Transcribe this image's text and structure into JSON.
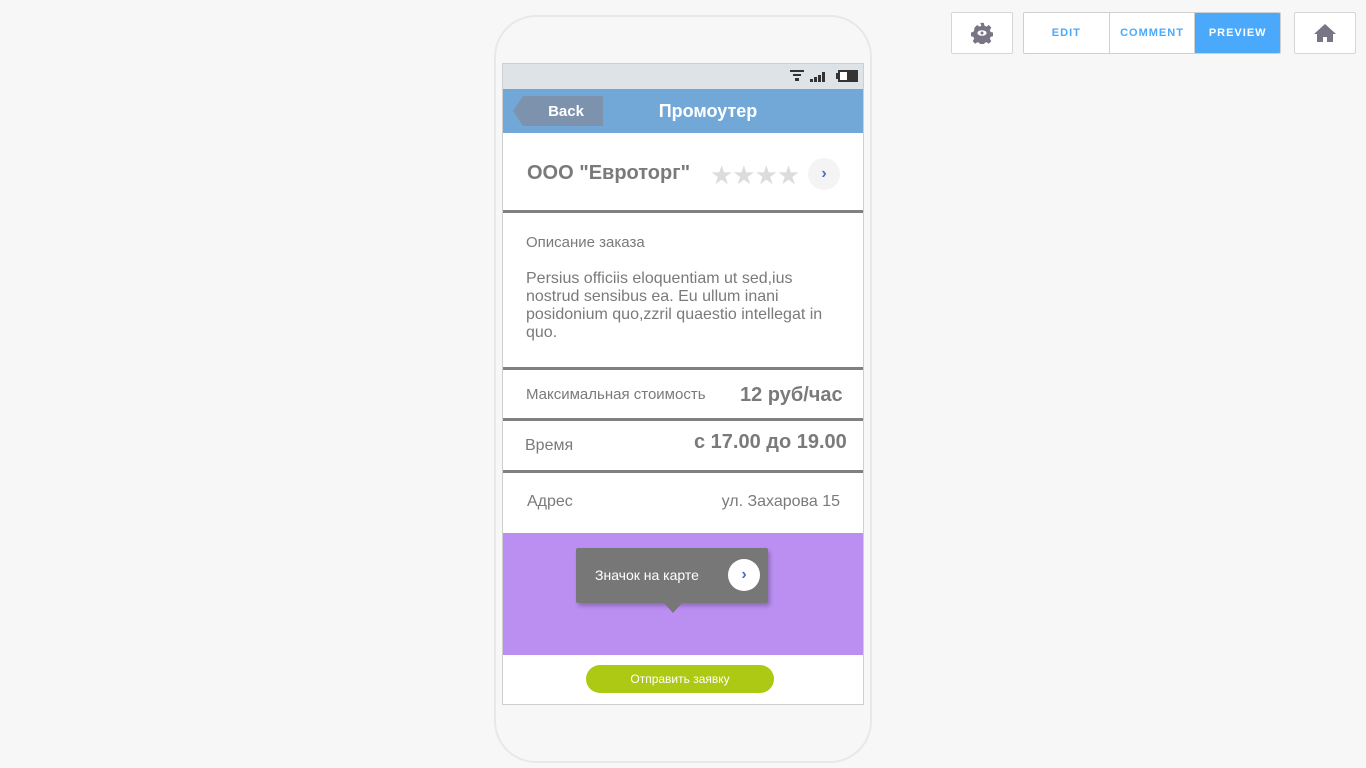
{
  "toolbar": {
    "gear_icon": "gear-eye-icon",
    "edit": "EDIT",
    "comment": "COMMENT",
    "preview": "PREVIEW",
    "home_icon": "home-icon",
    "accent": "#4aa9fb"
  },
  "header": {
    "back": "Back",
    "title": "Промоутер"
  },
  "company": {
    "name": "ООО \"Евроторг\"",
    "rating": 0,
    "max_rating": 4
  },
  "description": {
    "label": "Описание заказа",
    "text": "Persius officiis eloquentiam ut sed,ius nostrud sensibus ea. Eu ullum inani posidonium quo,zzril quaestio intellegat in quo."
  },
  "price": {
    "label": "Максимальная стоимость",
    "value": "12 руб/час"
  },
  "time": {
    "label": "Время",
    "value": "с 17.00 до 19.00"
  },
  "address": {
    "label": "Адрес",
    "value": "ул. Захарова 15"
  },
  "map": {
    "tooltip": "Значок на карте",
    "color": "#bb8ff2"
  },
  "submit": {
    "label": "Отправить заявку",
    "color": "#adc914"
  }
}
